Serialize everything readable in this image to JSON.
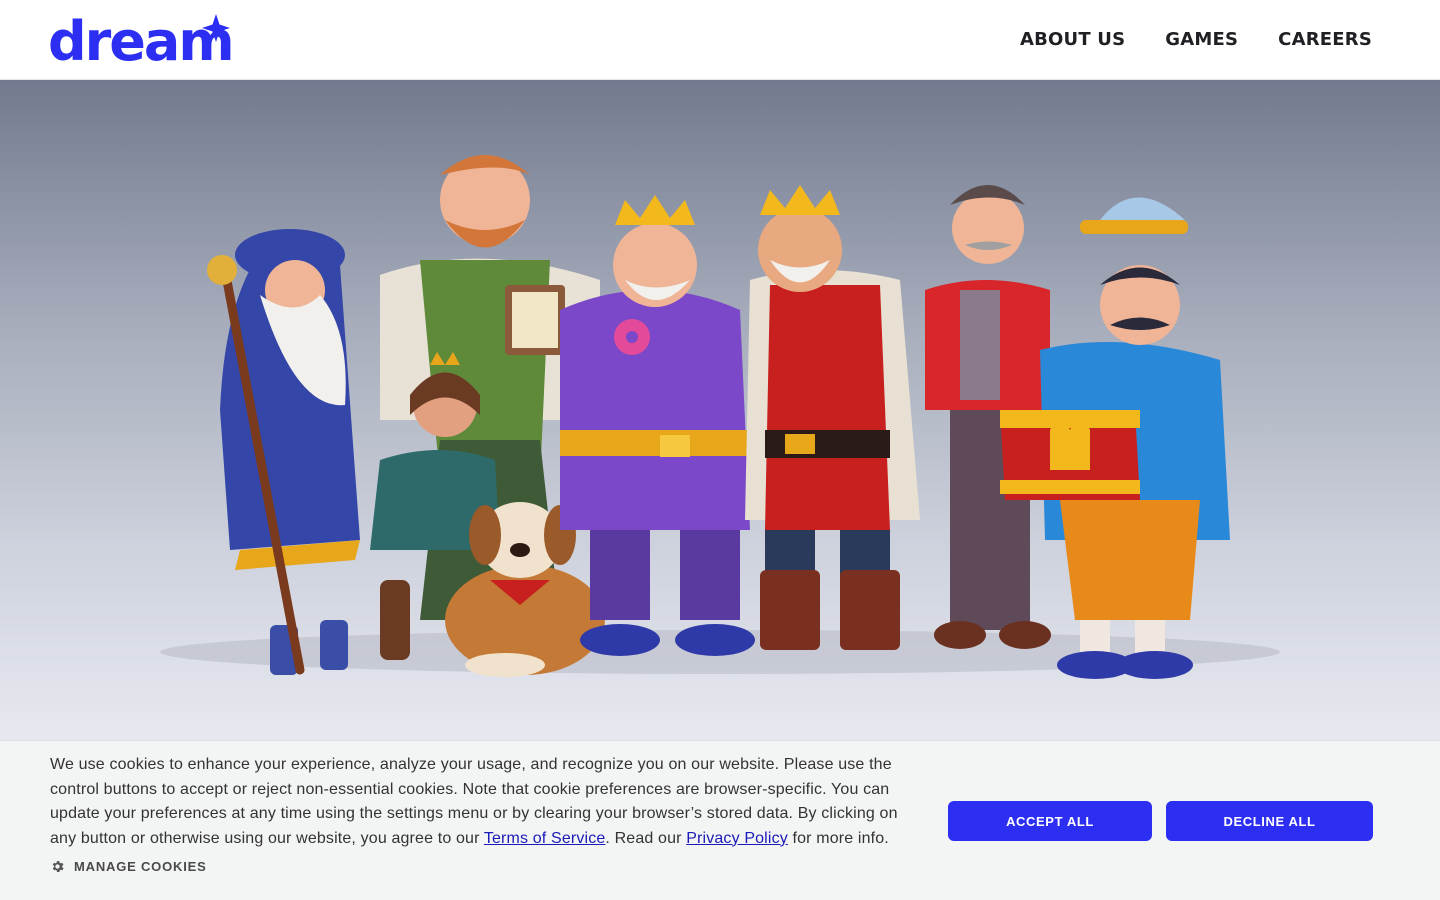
{
  "header": {
    "logo_text": "dream",
    "nav": [
      {
        "label": "ABOUT US"
      },
      {
        "label": "GAMES"
      },
      {
        "label": "CAREERS"
      }
    ]
  },
  "colors": {
    "brand": "#2c2ef2",
    "nav_text": "#1f1f24",
    "banner_bg": "#f3f4f4"
  },
  "cookie_banner": {
    "text_part1": "We use cookies to enhance your experience, analyze your usage, and recognize you on our website. Please use the control buttons to accept or reject non-essential cookies. Note that cookie preferences are browser-specific. You can update your preferences at any time using the settings menu or by clearing your browser’s stored data. By clicking on any button or otherwise using our website, you agree to our ",
    "terms_link": "Terms of Service",
    "text_part2": ". Read our ",
    "privacy_link": "Privacy Policy",
    "text_part3": " for more info.",
    "manage_label": "MANAGE COOKIES",
    "manage_icon": "gear-icon",
    "accept_label": "ACCEPT ALL",
    "decline_label": "DECLINE ALL"
  }
}
